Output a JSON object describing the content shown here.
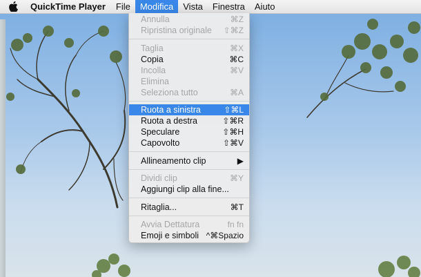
{
  "menubar": {
    "app_name": "QuickTime Player",
    "items": [
      "File",
      "Modifica",
      "Vista",
      "Finestra",
      "Aiuto"
    ]
  },
  "menu": {
    "items": [
      {
        "label": "Annulla",
        "shortcut": "⌘Z"
      },
      {
        "label": "Ripristina originale",
        "shortcut": "⇧⌘Z"
      },
      {
        "label": "Taglia",
        "shortcut": "⌘X"
      },
      {
        "label": "Copia",
        "shortcut": "⌘C"
      },
      {
        "label": "Incolla",
        "shortcut": "⌘V"
      },
      {
        "label": "Elimina",
        "shortcut": ""
      },
      {
        "label": "Seleziona tutto",
        "shortcut": "⌘A"
      },
      {
        "label": "Ruota a sinistra",
        "shortcut": "⇧⌘L"
      },
      {
        "label": "Ruota a destra",
        "shortcut": "⇧⌘R"
      },
      {
        "label": "Speculare",
        "shortcut": "⇧⌘H"
      },
      {
        "label": "Capovolto",
        "shortcut": "⇧⌘V"
      },
      {
        "label": "Allineamento clip",
        "shortcut": "▶"
      },
      {
        "label": "Dividi clip",
        "shortcut": "⌘Y"
      },
      {
        "label": "Aggiungi clip alla fine...",
        "shortcut": ""
      },
      {
        "label": "Ritaglia...",
        "shortcut": "⌘T"
      },
      {
        "label": "Avvia Dettatura",
        "shortcut": "fn fn"
      },
      {
        "label": "Emoji e simboli",
        "shortcut": "^⌘Spazio"
      }
    ]
  },
  "colors": {
    "highlight": "#3a87ea",
    "disabled": "#a6a6a6"
  }
}
